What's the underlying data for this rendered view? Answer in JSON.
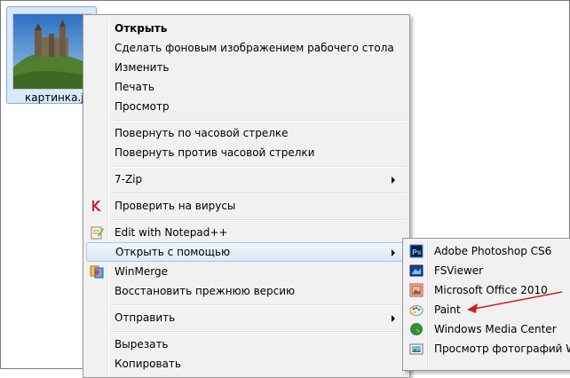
{
  "file": {
    "name": "картинка.jpg",
    "thumb_icon": "landscape-castle-thumbnail"
  },
  "context_menu": {
    "items": [
      {
        "label": "Открыть",
        "bold": true
      },
      {
        "label": "Сделать фоновым изображением рабочего стола"
      },
      {
        "label": "Изменить"
      },
      {
        "label": "Печать"
      },
      {
        "label": "Просмотр"
      },
      {
        "label": "Повернуть по часовой стрелке"
      },
      {
        "label": "Повернуть против часовой стрелки"
      },
      {
        "label": "7-Zip",
        "submenu": true
      },
      {
        "label": "Проверить на вирусы",
        "icon": "antivirus-icon"
      },
      {
        "label": "Edit with Notepad++",
        "icon": "notepad-plus-plus-icon"
      },
      {
        "label": "Открыть с помощью",
        "submenu": true,
        "highlighted": true
      },
      {
        "label": "WinMerge",
        "icon": "winmerge-icon"
      },
      {
        "label": "Восстановить прежнюю версию"
      },
      {
        "label": "Отправить",
        "submenu": true
      },
      {
        "label": "Вырезать"
      },
      {
        "label": "Копировать"
      }
    ]
  },
  "open_with_submenu": {
    "items": [
      {
        "label": "Adobe Photoshop CS6",
        "icon": "photoshop-icon"
      },
      {
        "label": "FSViewer",
        "icon": "fsviewer-icon"
      },
      {
        "label": "Microsoft Office 2010",
        "icon": "ms-office-picture-icon"
      },
      {
        "label": "Paint",
        "icon": "paint-icon"
      },
      {
        "label": "Windows Media Center",
        "icon": "media-center-icon"
      },
      {
        "label": "Просмотр фотографий Win",
        "icon": "photo-viewer-icon"
      }
    ]
  },
  "colors": {
    "highlight_border": "#a8c7ec",
    "selection_bg": "#d9e8fb",
    "annotation_arrow": "#cc2222"
  }
}
